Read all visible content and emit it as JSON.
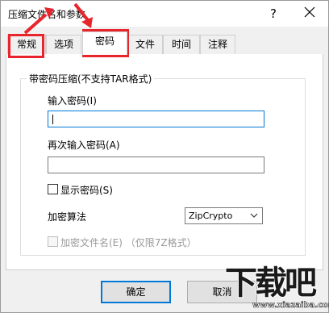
{
  "window": {
    "title": "压缩文件名和参数",
    "help_label": "?"
  },
  "tabs": [
    {
      "label": "常规"
    },
    {
      "label": "选项"
    },
    {
      "label": "密码"
    },
    {
      "label": "文件"
    },
    {
      "label": "时间"
    },
    {
      "label": "注释"
    }
  ],
  "active_tab": "密码",
  "group": {
    "title": "带密码压缩(不支持TAR格式)"
  },
  "password": {
    "label": "输入密码(I)",
    "value": ""
  },
  "confirm_password": {
    "label": "再次输入密码(A)",
    "value": ""
  },
  "show_password": {
    "label": "显示密码(S)",
    "checked": false
  },
  "encryption": {
    "label": "加密算法",
    "selected": "ZipCrypto"
  },
  "encrypt_filenames": {
    "label": "加密文件名(E)  （仅限7Z格式）",
    "checked": false,
    "enabled": false
  },
  "buttons": {
    "ok": "确定",
    "cancel": "取消"
  },
  "watermark": {
    "logo": "下载吧",
    "url": "www.xiazaiba.com"
  },
  "colors": {
    "annotation_red": "#e8242c",
    "focus_blue": "#0078d7",
    "window_bg": "#f0f0f0",
    "panel_bg": "#ffffff"
  }
}
